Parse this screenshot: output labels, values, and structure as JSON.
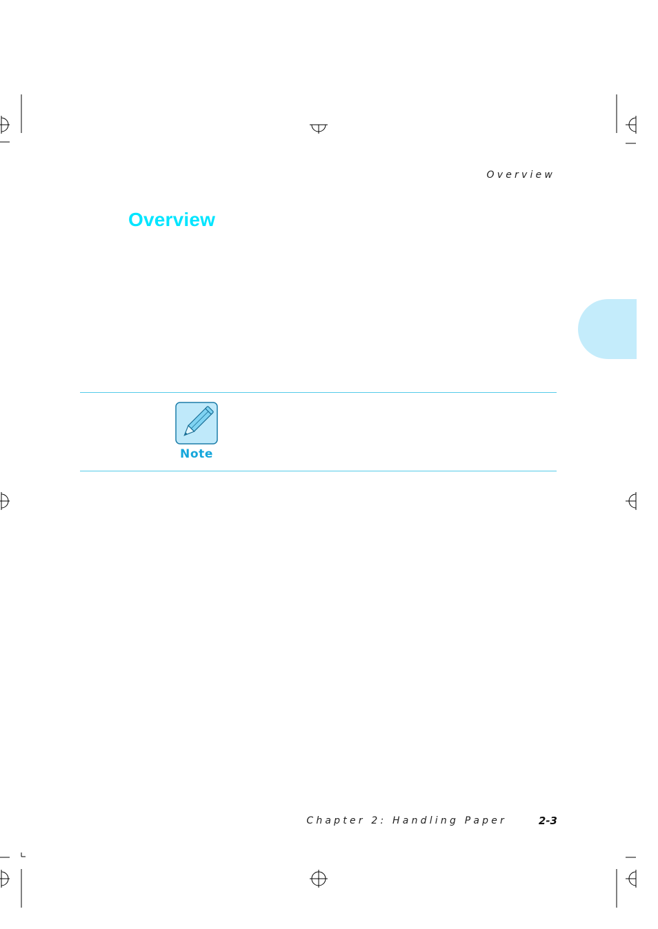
{
  "header": {
    "running_title": "Overview"
  },
  "section": {
    "heading": "Overview"
  },
  "note": {
    "label": "Note",
    "icon": "pencil-icon"
  },
  "footer": {
    "chapter": "Chapter 2: Handling Paper",
    "page_number": "2-3"
  },
  "colors": {
    "heading": "#00e5ff",
    "note_accent": "#14a6db",
    "thumb_tab": "#c4ecfb",
    "rule": "#52cbe9"
  }
}
